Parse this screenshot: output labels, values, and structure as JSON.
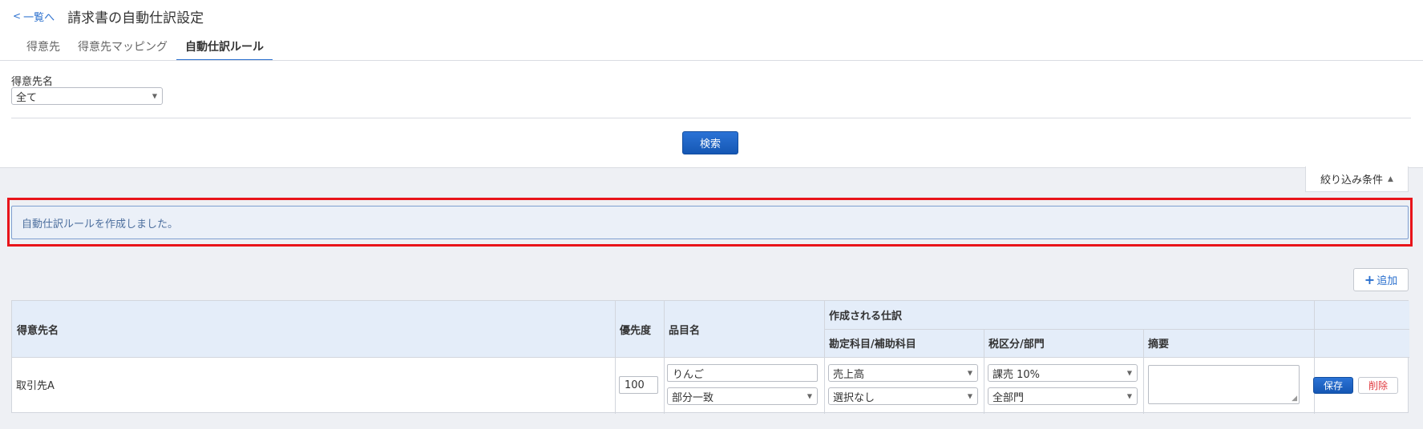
{
  "header": {
    "back_label": "一覧へ",
    "back_icon": "chevron-left-icon",
    "title": "請求書の自動仕訳設定"
  },
  "tabs": [
    {
      "label": "得意先",
      "active": false
    },
    {
      "label": "得意先マッピング",
      "active": false
    },
    {
      "label": "自動仕訳ルール",
      "active": true
    }
  ],
  "filter": {
    "customer_label": "得意先名",
    "customer_value": "全て",
    "search_label": "検索",
    "toggle_label": "絞り込み条件",
    "toggle_icon": "triangle-up-icon"
  },
  "flash": {
    "message": "自動仕訳ルールを作成しました。"
  },
  "actions": {
    "add_label": "追加",
    "add_icon": "plus-icon"
  },
  "table": {
    "headers": {
      "customer": "得意先名",
      "priority": "優先度",
      "item_name": "品目名",
      "generated": "作成される仕訳",
      "account": "勘定科目/補助科目",
      "tax": "税区分/部門",
      "memo": "摘要"
    },
    "rows": [
      {
        "customer": "取引先A",
        "priority": "100",
        "item_name": "りんご",
        "match_type": "部分一致",
        "account": "売上高",
        "sub_account": "選択なし",
        "tax": "課売 10%",
        "department": "全部門",
        "memo": "",
        "save_label": "保存",
        "delete_label": "削除"
      }
    ]
  },
  "colors": {
    "primary": "#1f66c9",
    "highlight": "#e8141a",
    "danger": "#e0393e",
    "flash_bg": "#ebf0f8",
    "header_bg": "#e4edf9"
  }
}
